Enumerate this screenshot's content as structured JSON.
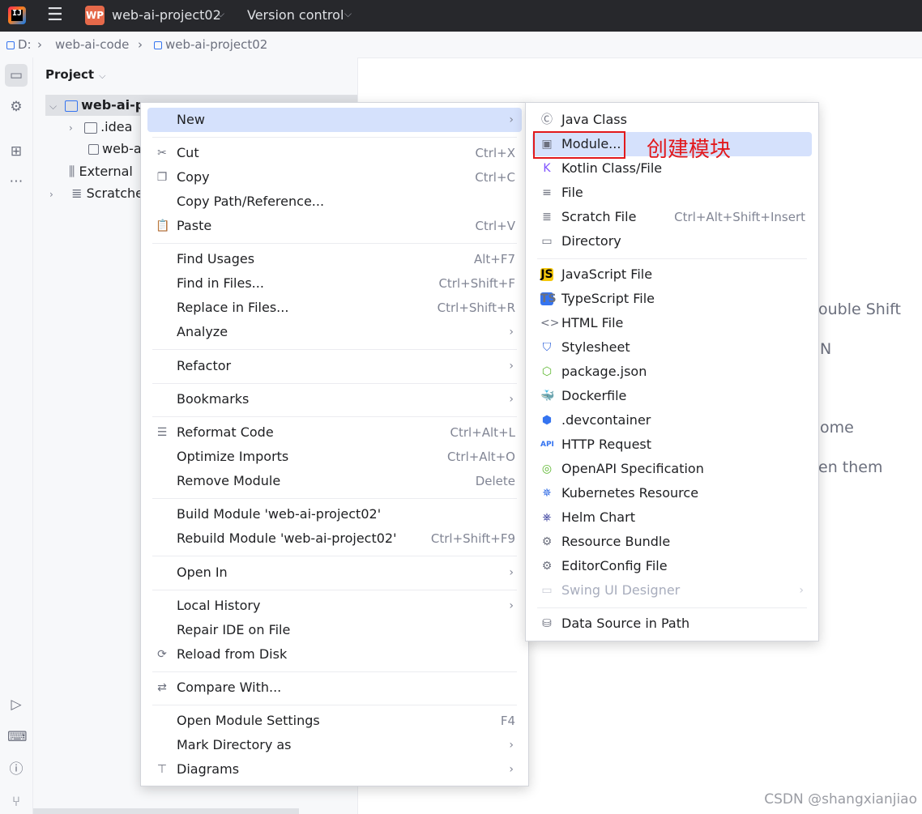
{
  "titlebar": {
    "project_badge": "WP",
    "project_name": "web-ai-project02",
    "version_control": "Version control"
  },
  "breadcrumb": [
    "D:",
    "web-ai-code",
    "web-ai-project02"
  ],
  "project_panel": {
    "title": "Project",
    "tree": [
      {
        "label": "web-ai-p",
        "level": 0,
        "expanded": true,
        "selected": true
      },
      {
        "label": ".idea",
        "level": 1,
        "expanded": false
      },
      {
        "label": "web-a",
        "level": 1
      },
      {
        "label": "External",
        "level": 0
      },
      {
        "label": "Scratche",
        "level": 0,
        "expanded": false
      }
    ]
  },
  "context_menu": {
    "items": [
      {
        "label": "New",
        "arrow": true,
        "highlighted": true
      },
      {
        "label": "Cut",
        "shortcut": "Ctrl+X",
        "icon": "scissors-icon"
      },
      {
        "label": "Copy",
        "shortcut": "Ctrl+C",
        "icon": "copy-icon"
      },
      {
        "label": "Copy Path/Reference..."
      },
      {
        "label": "Paste",
        "shortcut": "Ctrl+V",
        "icon": "clipboard-icon"
      },
      {
        "label": "Find Usages",
        "shortcut": "Alt+F7"
      },
      {
        "label": "Find in Files...",
        "shortcut": "Ctrl+Shift+F"
      },
      {
        "label": "Replace in Files...",
        "shortcut": "Ctrl+Shift+R"
      },
      {
        "label": "Analyze",
        "arrow": true
      },
      {
        "label": "Refactor",
        "arrow": true
      },
      {
        "label": "Bookmarks",
        "arrow": true
      },
      {
        "label": "Reformat Code",
        "shortcut": "Ctrl+Alt+L",
        "icon": "reformat-icon"
      },
      {
        "label": "Optimize Imports",
        "shortcut": "Ctrl+Alt+O"
      },
      {
        "label": "Remove Module",
        "shortcut": "Delete"
      },
      {
        "label": "Build Module 'web-ai-project02'"
      },
      {
        "label": "Rebuild Module 'web-ai-project02'",
        "shortcut": "Ctrl+Shift+F9"
      },
      {
        "label": "Open In",
        "arrow": true
      },
      {
        "label": "Local History",
        "arrow": true
      },
      {
        "label": "Repair IDE on File"
      },
      {
        "label": "Reload from Disk",
        "icon": "reload-icon"
      },
      {
        "label": "Compare With...",
        "icon": "compare-icon"
      },
      {
        "label": "Open Module Settings",
        "shortcut": "F4"
      },
      {
        "label": "Mark Directory as",
        "arrow": true
      },
      {
        "label": "Diagrams",
        "arrow": true,
        "icon": "diagrams-icon"
      }
    ]
  },
  "submenu_new": {
    "items": [
      {
        "label": "Java Class",
        "icon": "java-class-icon"
      },
      {
        "label": "Module...",
        "icon": "module-icon",
        "highlighted": true
      },
      {
        "label": "Kotlin Class/File",
        "icon": "kotlin-icon"
      },
      {
        "label": "File",
        "icon": "file-icon"
      },
      {
        "label": "Scratch File",
        "shortcut": "Ctrl+Alt+Shift+Insert",
        "icon": "scratch-icon"
      },
      {
        "label": "Directory",
        "icon": "folder-icon"
      },
      {
        "label": "JavaScript File",
        "icon": "js-icon",
        "badge": "JS"
      },
      {
        "label": "TypeScript File",
        "icon": "ts-icon",
        "badge": "TS"
      },
      {
        "label": "HTML File",
        "icon": "html-icon"
      },
      {
        "label": "Stylesheet",
        "icon": "css-icon"
      },
      {
        "label": "package.json",
        "icon": "nodejs-icon"
      },
      {
        "label": "Dockerfile",
        "icon": "docker-icon"
      },
      {
        "label": ".devcontainer",
        "icon": "devcontainer-icon"
      },
      {
        "label": "HTTP Request",
        "icon": "api-icon",
        "badge": "API"
      },
      {
        "label": "OpenAPI Specification",
        "icon": "openapi-icon"
      },
      {
        "label": "Kubernetes Resource",
        "icon": "kubernetes-icon"
      },
      {
        "label": "Helm Chart",
        "icon": "helm-icon"
      },
      {
        "label": "Resource Bundle",
        "icon": "gear-icon"
      },
      {
        "label": "EditorConfig File",
        "icon": "gear-icon"
      },
      {
        "label": "Swing UI Designer",
        "arrow": true,
        "disabled": true,
        "icon": "window-icon"
      },
      {
        "label": "Data Source in Path",
        "icon": "database-icon"
      }
    ]
  },
  "background_hints": [
    "ouble Shift",
    "N",
    "ome",
    "en them"
  ],
  "annotation": "创建模块",
  "watermark": "CSDN @shangxianjiao",
  "colors": {
    "highlight": "#d5e1fc",
    "annotation_red": "#e2191c",
    "accent": "#3574f0"
  }
}
